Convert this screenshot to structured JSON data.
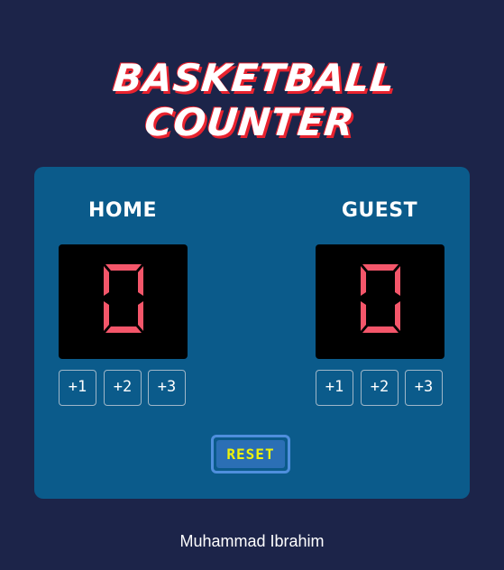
{
  "app": {
    "title": "BASKETBALL COUNTER",
    "author": "Muhammad Ibrahim"
  },
  "home": {
    "label": "HOME",
    "score": "0",
    "buttons": [
      "+1",
      "+2",
      "+3"
    ]
  },
  "guest": {
    "label": "GUEST",
    "score": "0",
    "buttons": [
      "+1",
      "+2",
      "+3"
    ]
  },
  "reset": {
    "label": "RESET"
  },
  "colors": {
    "background": "#1c2449",
    "board": "#0b5b8b",
    "score_digit": "#f4566a",
    "title_shadow": "#e8232f",
    "reset_text": "#eef20c",
    "reset_border": "#4f8fdd"
  },
  "icons": {
    "score_display": "seven-segment-digit"
  }
}
